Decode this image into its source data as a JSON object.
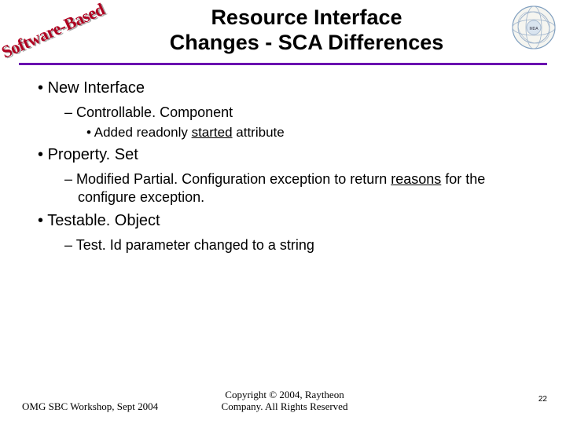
{
  "badge_text": "Software-Based",
  "title_line1": "Resource Interface",
  "title_line2": "Changes - SCA Differences",
  "bullets": {
    "b1": "New Interface",
    "b1_1": "Controllable. Component",
    "b1_1_1_pre": "Added readonly ",
    "b1_1_1_u": "started",
    "b1_1_1_post": " attribute",
    "b2": "Property. Set",
    "b2_1_pre": "Modified Partial. Configuration exception to return ",
    "b2_1_u": "reasons",
    "b2_1_post": " for the configure exception.",
    "b3": "Testable. Object",
    "b3_1": "Test. Id parameter changed to a string"
  },
  "footer": {
    "left": "OMG SBC Workshop, Sept 2004",
    "center_l1": "Copyright © 2004, Raytheon",
    "center_l2": "Company. All Rights Reserved",
    "page": "22"
  }
}
